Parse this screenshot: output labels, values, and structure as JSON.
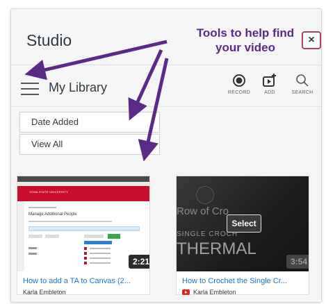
{
  "app": {
    "title": "Studio",
    "close_label": "×"
  },
  "annotation": {
    "text": "Tools to help find your video"
  },
  "header": {
    "library_label": "My Library",
    "tools": [
      {
        "label": "RECORD",
        "icon": "record-icon"
      },
      {
        "label": "ADD",
        "icon": "add-video-icon"
      },
      {
        "label": "SEARCH",
        "icon": "search-icon"
      }
    ]
  },
  "filters": {
    "sort_value": "Date Added",
    "view_value": "View All"
  },
  "videos": [
    {
      "title": "How to add a TA to Canvas (2...",
      "author": "Karla Embleton",
      "duration": "2:21"
    },
    {
      "title": "How to Crochet the Single Cr...",
      "author": "Karla Embleton",
      "duration": "3:54",
      "overlay_button": "Select",
      "thumb_text": [
        "Row of Cro",
        "SINGLE CROCH",
        "THERMAL"
      ],
      "source_icon": "youtube-icon"
    }
  ],
  "thumb1": {
    "banner_title": "IOWA STATE UNIVERSITY",
    "page_heading": "Manage Additional People"
  },
  "colors": {
    "annotation": "#5b2a86",
    "link": "#2276c5",
    "close_border": "#b0415a",
    "isu_red": "#c8102e"
  }
}
